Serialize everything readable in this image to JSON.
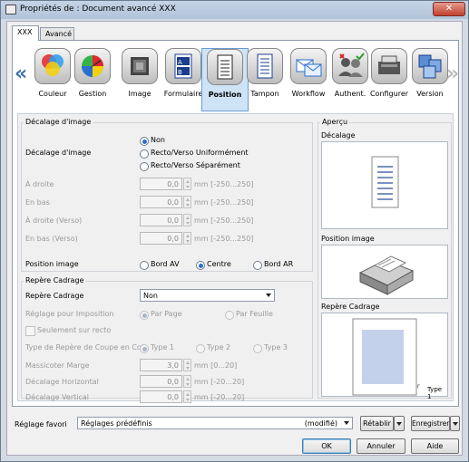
{
  "window": {
    "title": "Propriétés de : Document avancé XXX",
    "close_label": "✕"
  },
  "tabs": [
    {
      "label": "XXX"
    },
    {
      "label": "Avancé"
    }
  ],
  "categories": [
    {
      "label": "Couleur",
      "icon": "color-circles-icon"
    },
    {
      "label": "Gestion",
      "icon": "color-wheel-icon"
    },
    {
      "label": "Image",
      "icon": "image-gradient-icon"
    },
    {
      "label": "Formulaire",
      "icon": "form-ab-icon"
    },
    {
      "label": "Position",
      "icon": "document-position-icon"
    },
    {
      "label": "Tampon",
      "icon": "stamp-document-icon"
    },
    {
      "label": "Workflow",
      "icon": "workflow-envelopes-icon"
    },
    {
      "label": "Authent.",
      "icon": "authentication-users-icon"
    },
    {
      "label": "Configurer",
      "icon": "printer-configure-icon"
    },
    {
      "label": "Version",
      "icon": "version-windows-icon"
    }
  ],
  "decalage": {
    "group_title": "Décalage d'image",
    "label": "Décalage d'image",
    "options": [
      "Non",
      "Recto/Verso Uniformément",
      "Recto/Verso Séparément"
    ],
    "selected": "Non",
    "fields": [
      {
        "label": "À droite",
        "value": "0,0",
        "unit": "mm [-250...250]"
      },
      {
        "label": "En bas",
        "value": "0,0",
        "unit": "mm [-250...250]"
      },
      {
        "label": "À droite (Verso)",
        "value": "0,0",
        "unit": "mm [-250...250]"
      },
      {
        "label": "En bas (Verso)",
        "value": "0,0",
        "unit": "mm [-250...250]"
      }
    ]
  },
  "position_image": {
    "label": "Position image",
    "options": [
      "Bord AV",
      "Centre",
      "Bord AR"
    ],
    "selected": "Centre"
  },
  "repere": {
    "group_title": "Repère Cadrage",
    "label": "Repère Cadrage",
    "select_value": "Non",
    "imposition_label": "Réglage pour Imposition",
    "imposition_options": [
      "Par Page",
      "Par Feuille"
    ],
    "imposition_selected": "Par Page",
    "recto_only": "Seulement sur recto",
    "coupe_label": "Type de Repère de Coupe en Coin",
    "coupe_options": [
      "Type 1",
      "Type 2",
      "Type 3"
    ],
    "coupe_selected": "Type 1",
    "fields": [
      {
        "label": "Massicoter Marge",
        "value": "3,0",
        "unit": "mm [0...20]"
      },
      {
        "label": "Décalage Horizontal",
        "value": "0,0",
        "unit": "mm [-20...20]"
      },
      {
        "label": "Décalage Vertical",
        "value": "0,0",
        "unit": "mm [-20...20]"
      }
    ]
  },
  "apercu": {
    "title": "Aperçu",
    "decalage_label": "Décalage",
    "position_label": "Position image",
    "repere_label": "Repère Cadrage",
    "type_label": "Type 1"
  },
  "favorites": {
    "label": "Réglage favori",
    "value": "Réglages prédéfinis",
    "modified": "(modifié)",
    "restore": "Rétablir",
    "save": "Enregistrer"
  },
  "buttons": {
    "ok": "OK",
    "cancel": "Annuler",
    "help": "Aide"
  },
  "colors": {
    "accent": "#2a6fd0",
    "preview_page": "#c3d2ea",
    "title_bg": "#c4d3e6"
  }
}
